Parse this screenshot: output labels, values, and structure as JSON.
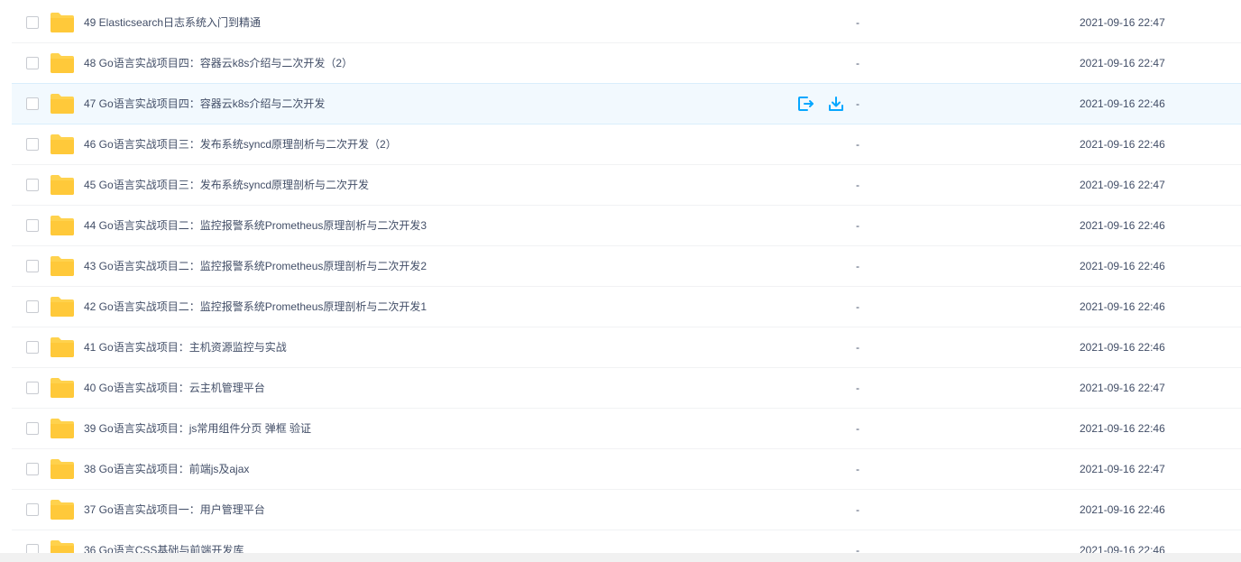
{
  "files": [
    {
      "name": "49 Elasticsearch日志系统入门到精通",
      "size": "-",
      "date": "2021-09-16 22:47"
    },
    {
      "name": "48 Go语言实战项目四：容器云k8s介绍与二次开发（2）",
      "size": "-",
      "date": "2021-09-16 22:47"
    },
    {
      "name": "47 Go语言实战项目四：容器云k8s介绍与二次开发",
      "size": "-",
      "date": "2021-09-16 22:46"
    },
    {
      "name": "46 Go语言实战项目三：发布系统syncd原理剖析与二次开发（2）",
      "size": "-",
      "date": "2021-09-16 22:46"
    },
    {
      "name": "45 Go语言实战项目三：发布系统syncd原理剖析与二次开发",
      "size": "-",
      "date": "2021-09-16 22:47"
    },
    {
      "name": "44 Go语言实战项目二：监控报警系统Prometheus原理剖析与二次开发3",
      "size": "-",
      "date": "2021-09-16 22:46"
    },
    {
      "name": "43 Go语言实战项目二：监控报警系统Prometheus原理剖析与二次开发2",
      "size": "-",
      "date": "2021-09-16 22:46"
    },
    {
      "name": "42 Go语言实战项目二：监控报警系统Prometheus原理剖析与二次开发1",
      "size": "-",
      "date": "2021-09-16 22:46"
    },
    {
      "name": "41 Go语言实战项目：主机资源监控与实战",
      "size": "-",
      "date": "2021-09-16 22:46"
    },
    {
      "name": "40 Go语言实战项目：云主机管理平台",
      "size": "-",
      "date": "2021-09-16 22:47"
    },
    {
      "name": "39 Go语言实战项目：js常用组件分页 弹框 验证",
      "size": "-",
      "date": "2021-09-16 22:46"
    },
    {
      "name": "38 Go语言实战项目：前端js及ajax",
      "size": "-",
      "date": "2021-09-16 22:47"
    },
    {
      "name": "37 Go语言实战项目一：用户管理平台",
      "size": "-",
      "date": "2021-09-16 22:46"
    },
    {
      "name": "36 Go语言CSS基础与前端开发库",
      "size": "-",
      "date": "2021-09-16 22:46"
    }
  ],
  "hovered_index": 2,
  "hover_actions": {
    "share_icon": "share-export-icon",
    "download_icon": "download-icon"
  },
  "colors": {
    "accent": "#06a7ff",
    "folder": "#ffd24d",
    "text": "#424e67",
    "hover_bg": "#f2f9fe"
  }
}
